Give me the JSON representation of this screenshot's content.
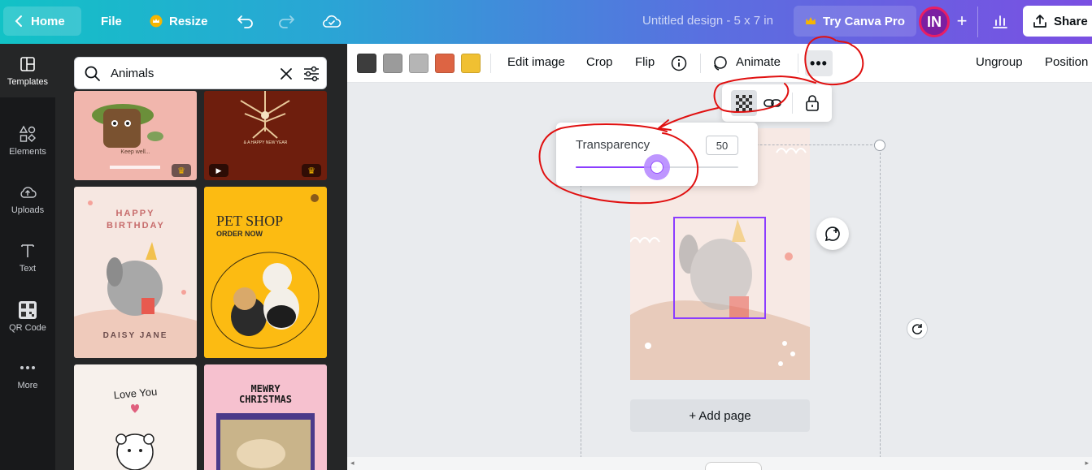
{
  "topbar": {
    "home": "Home",
    "file": "File",
    "resize": "Resize",
    "doc_title": "Untitled design - 5 x 7 in",
    "try_pro": "Try Canva Pro",
    "avatar_initials": "IN",
    "share": "Share"
  },
  "rail": {
    "items": [
      {
        "label": "Templates",
        "icon": "templates-icon"
      },
      {
        "label": "Elements",
        "icon": "elements-icon"
      },
      {
        "label": "Uploads",
        "icon": "uploads-icon"
      },
      {
        "label": "Text",
        "icon": "text-icon"
      },
      {
        "label": "QR Code",
        "icon": "qr-code-icon"
      },
      {
        "label": "More",
        "icon": "more-icon"
      }
    ]
  },
  "panel": {
    "search_value": "Animals",
    "templates": {
      "t1_text": "Keep well...",
      "t2_text": "& A HAPPY NEW YEAR",
      "t3_title": "HAPPY BIRTHDAY",
      "t3_name": "DAISY JANE",
      "t4_title": "PET SHOP",
      "t4_sub": "ORDER NOW",
      "t5_text": "Love You",
      "t6_title": "MEWRY CHRISTMAS"
    }
  },
  "context_toolbar": {
    "colors": [
      "#3d3d3d",
      "#9b9b9b",
      "#b5b5b5",
      "#dd6443",
      "#f0c032"
    ],
    "edit_image": "Edit image",
    "crop": "Crop",
    "flip": "Flip",
    "animate": "Animate",
    "ungroup": "Ungroup",
    "position": "Position"
  },
  "transparency": {
    "label": "Transparency",
    "value": "50",
    "percent": 50
  },
  "canvas": {
    "add_page": "+ Add page"
  },
  "accent": "#8b3dff",
  "annotation_color": "#e01010"
}
